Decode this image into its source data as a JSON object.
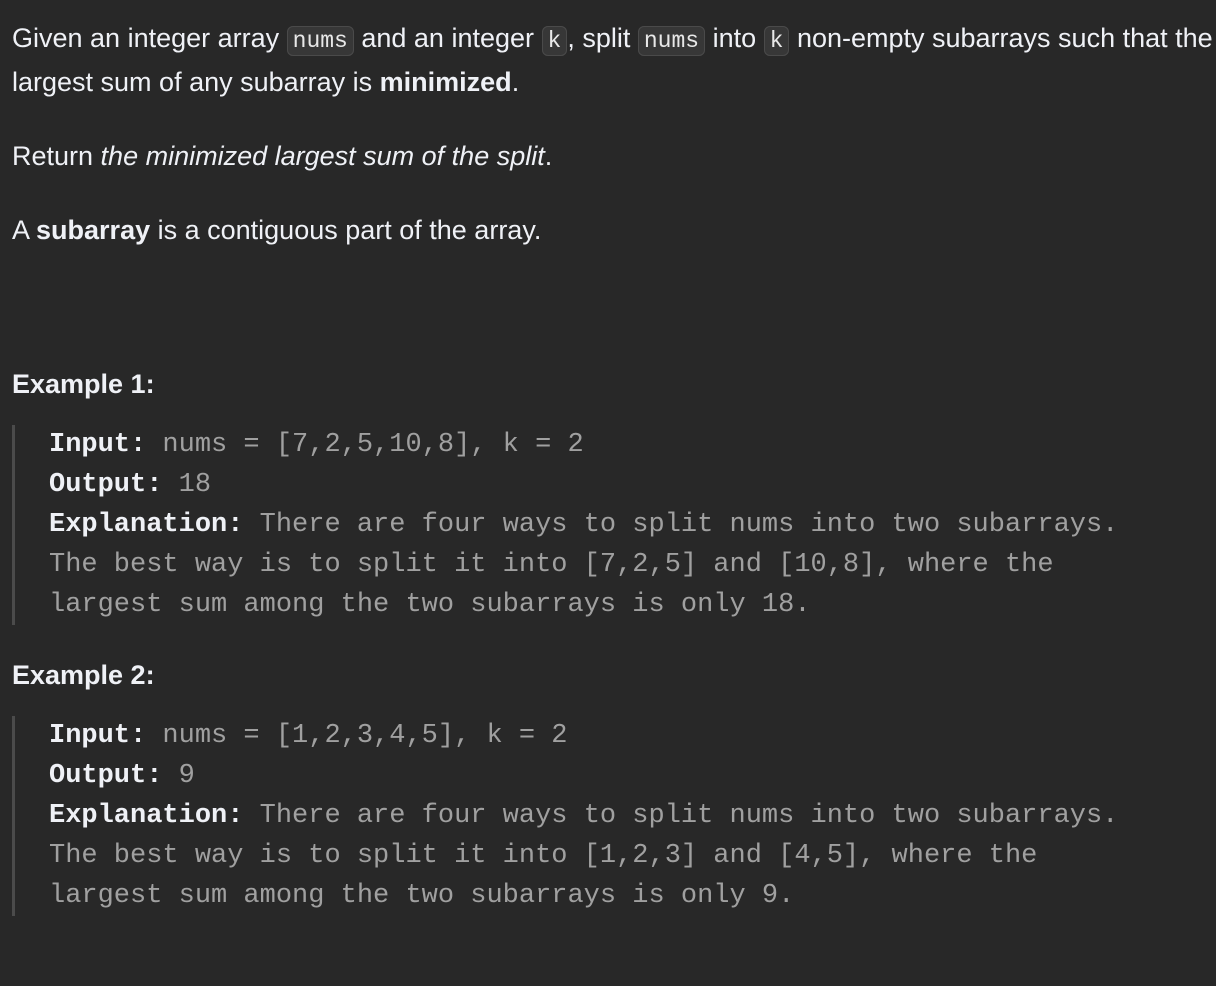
{
  "problem": {
    "intro": {
      "t1": "Given an integer array ",
      "code1": "nums",
      "t2": " and an integer ",
      "code2": "k",
      "t3": ", split ",
      "code3": "nums",
      "t4": " into ",
      "code4": "k",
      "t5": " non-empty subarrays such that the largest sum of any subarray is ",
      "bold1": "minimized",
      "t6": "."
    },
    "return_line": {
      "t1": "Return ",
      "ital": "the minimized largest sum of the split",
      "t2": "."
    },
    "subarray_line": {
      "t1": "A ",
      "bold": "subarray",
      "t2": " is a contiguous part of the array."
    }
  },
  "examples": [
    {
      "title": "Example 1:",
      "input_label": "Input:",
      "input_value": " nums = [7,2,5,10,8], k = 2",
      "output_label": "Output:",
      "output_value": " 18",
      "explanation_label": "Explanation:",
      "explanation_line1": " There are four ways to split nums into two subarrays.",
      "explanation_line2": "The best way is to split it into [7,2,5] and [10,8], where the",
      "explanation_line3": "largest sum among the two subarrays is only 18."
    },
    {
      "title": "Example 2:",
      "input_label": "Input:",
      "input_value": " nums = [1,2,3,4,5], k = 2",
      "output_label": "Output:",
      "output_value": " 9",
      "explanation_label": "Explanation:",
      "explanation_line1": " There are four ways to split nums into two subarrays.",
      "explanation_line2": "The best way is to split it into [1,2,3] and [4,5], where the",
      "explanation_line3": "largest sum among the two subarrays is only 9."
    }
  ]
}
